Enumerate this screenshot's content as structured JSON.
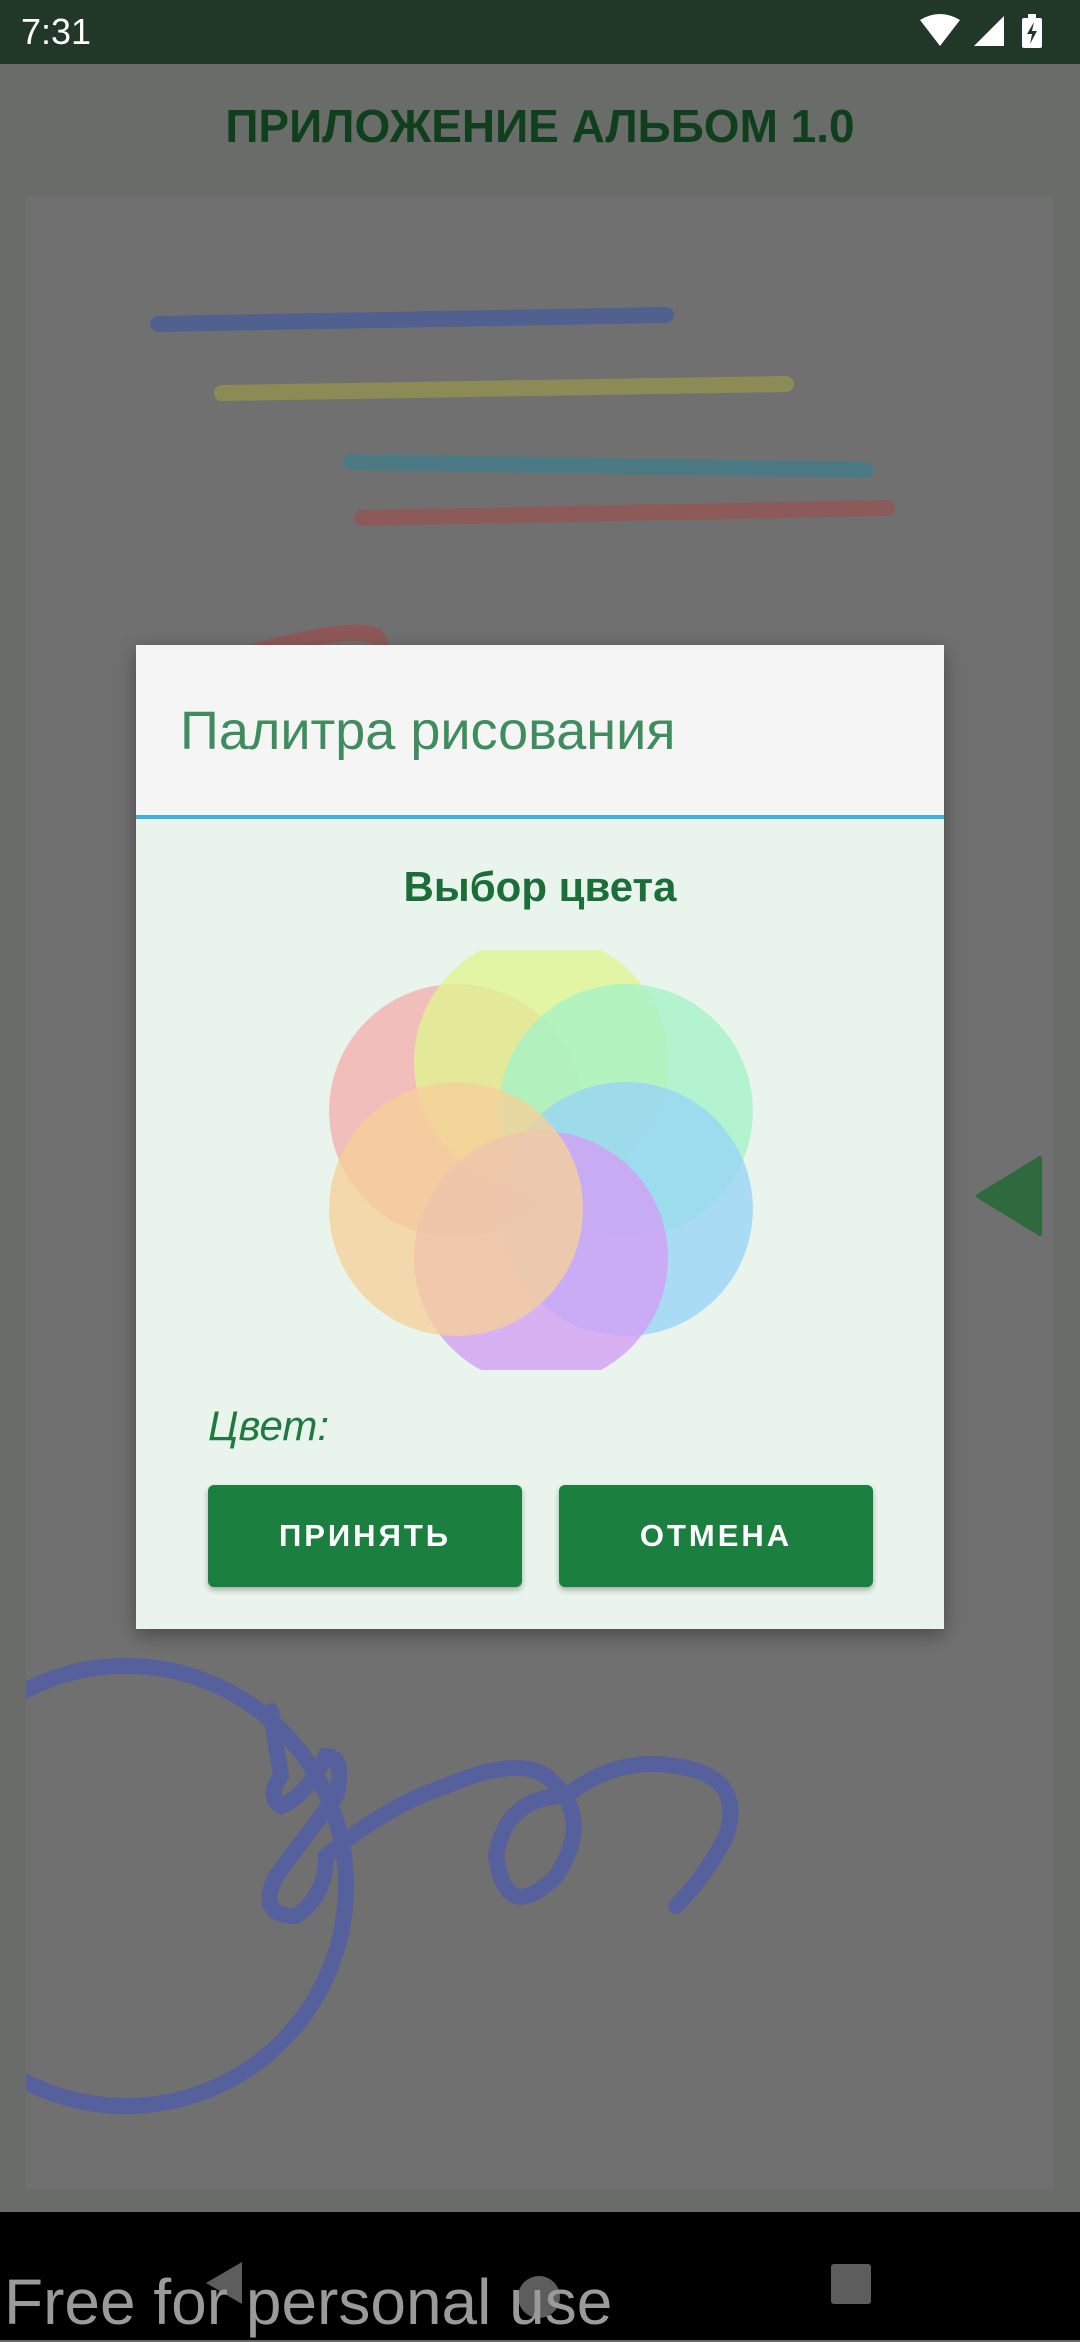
{
  "status_bar": {
    "time": "7:31",
    "icons": [
      "wifi-icon",
      "cellular-signal-icon",
      "battery-charging-icon"
    ]
  },
  "app": {
    "title": "ПРИЛОЖЕНИЕ АЛЬБОМ 1.0"
  },
  "dialog": {
    "title": "Палитра рисования",
    "subtitle": "Выбор цвета",
    "color_label": "Цвет:",
    "accept_label": "ПРИНЯТЬ",
    "cancel_label": "ОТМЕНА",
    "palette_colors": [
      "#f3aeae",
      "#e0f590",
      "#a4f2c6",
      "#97d4f6",
      "#d49ef5",
      "#f6cf98"
    ]
  },
  "nav_bar": {
    "icons": [
      "back-icon",
      "home-icon",
      "recent-apps-icon"
    ]
  },
  "watermark": "Free for personal use",
  "colors": {
    "status_bar": "#213728",
    "accent_green": "#1a7f3f",
    "dialog_divider": "#3fb0d9",
    "dialog_body": "#e8f4ec"
  }
}
